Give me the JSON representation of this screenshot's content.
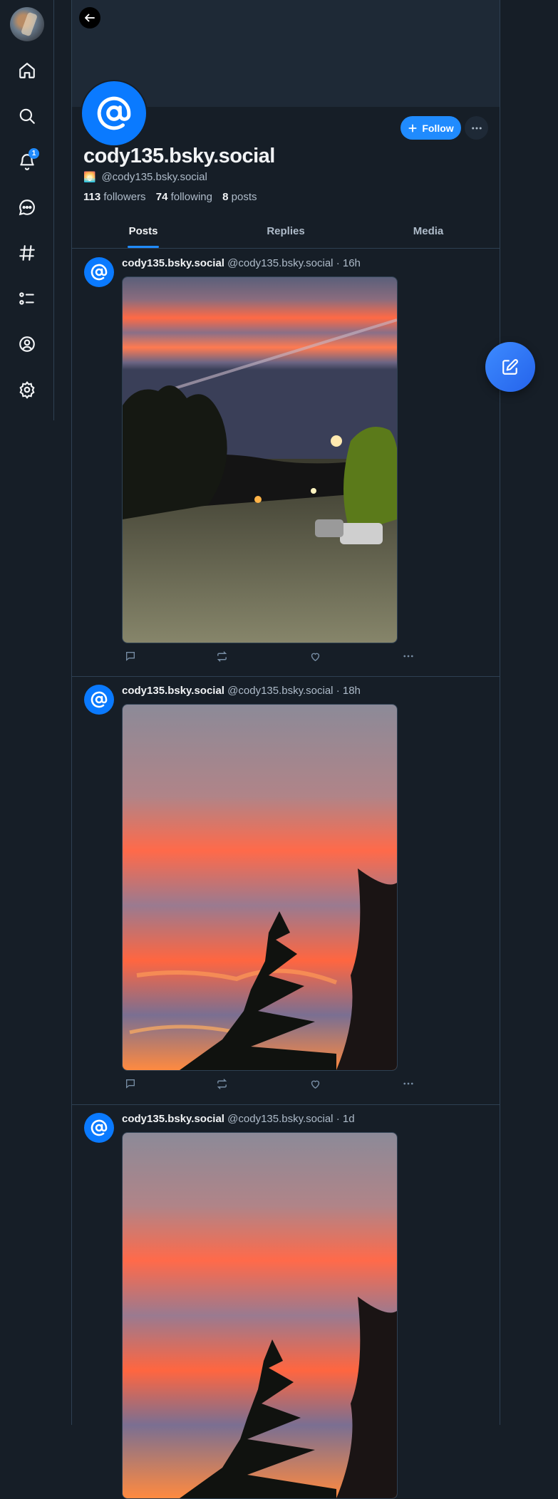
{
  "nav": {
    "notification_count": "1",
    "items": [
      "home-icon",
      "search-icon",
      "bell-icon",
      "chat-icon",
      "hashtag-icon",
      "list-icon",
      "profile-icon",
      "settings-icon"
    ]
  },
  "profile": {
    "display_name": "cody135.bsky.social",
    "handle": "@cody135.bsky.social",
    "handle_emoji": "🌅",
    "followers_count": "113",
    "followers_label": "followers",
    "following_count": "74",
    "following_label": "following",
    "posts_count": "8",
    "posts_label": "posts",
    "follow_label": "Follow"
  },
  "tabs": [
    {
      "label": "Posts",
      "active": true
    },
    {
      "label": "Replies",
      "active": false
    },
    {
      "label": "Media",
      "active": false
    }
  ],
  "posts": [
    {
      "author": "cody135.bsky.social",
      "handle": "@cody135.bsky.social",
      "time": "· 16h",
      "image": "sunset street photo"
    },
    {
      "author": "cody135.bsky.social",
      "handle": "@cody135.bsky.social",
      "time": "· 18h",
      "image": "sunset sky with trees"
    },
    {
      "author": "cody135.bsky.social",
      "handle": "@cody135.bsky.social",
      "time": "· 1d",
      "image": "sunset sky with trees"
    }
  ],
  "colors": {
    "accent": "#208bfe",
    "background": "#161e27",
    "border": "#2e4052",
    "text_secondary": "#aebbc9"
  }
}
